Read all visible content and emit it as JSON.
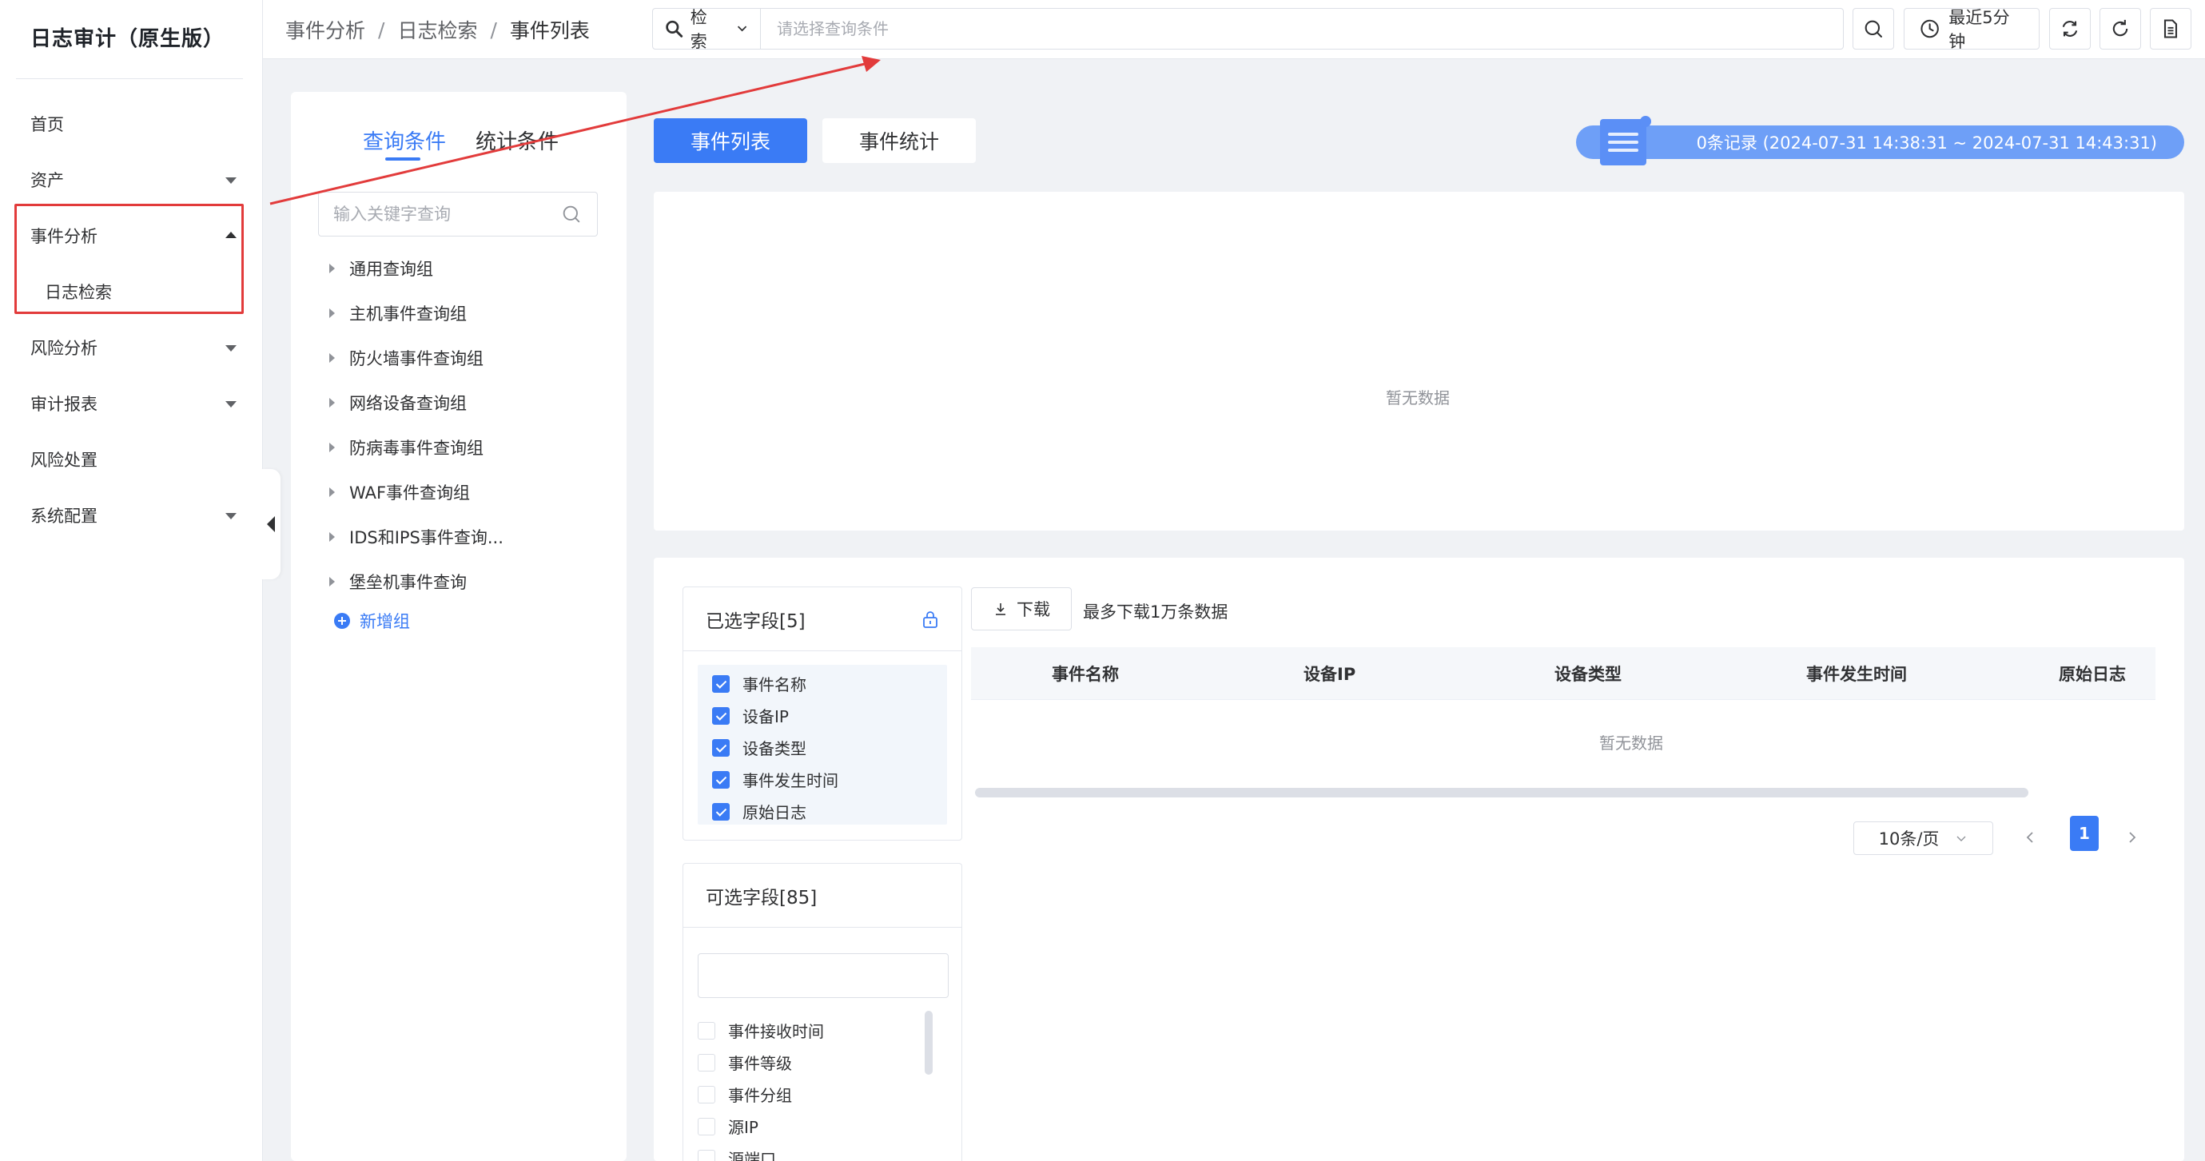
{
  "app": {
    "title": "日志审计（原生版）"
  },
  "sidebar": {
    "items": [
      {
        "label": "首页"
      },
      {
        "label": "资产"
      },
      {
        "label": "事件分析"
      },
      {
        "label": "日志检索"
      },
      {
        "label": "风险分析"
      },
      {
        "label": "审计报表"
      },
      {
        "label": "风险处置"
      },
      {
        "label": "系统配置"
      }
    ]
  },
  "header": {
    "breadcrumb": [
      "事件分析",
      "日志检索",
      "事件列表"
    ],
    "breadcrumb_sep": "/",
    "search_type": "检索",
    "search_placeholder": "请选择查询条件",
    "time_range": "最近5分钟"
  },
  "query_panel": {
    "tabs": [
      "查询条件",
      "统计条件"
    ],
    "search_placeholder": "输入关键字查询",
    "groups": [
      "通用查询组",
      "主机事件查询组",
      "防火墙事件查询组",
      "网络设备查询组",
      "防病毒事件查询组",
      "WAF事件查询组",
      "IDS和IPS事件查询...",
      "堡垒机事件查询"
    ],
    "add_group": "新增组"
  },
  "main": {
    "tabs": [
      "事件列表",
      "事件统计"
    ],
    "record_info": "0条记录 (2024-07-31 14:38:31 ~ 2024-07-31 14:43:31)",
    "chart_empty": "暂无数据"
  },
  "fields": {
    "selected_title": "已选字段[5]",
    "selected": [
      "事件名称",
      "设备IP",
      "设备类型",
      "事件发生时间",
      "原始日志"
    ],
    "optional_title": "可选字段[85]",
    "optional": [
      "事件接收时间",
      "事件等级",
      "事件分组",
      "源IP",
      "源端口"
    ]
  },
  "table": {
    "download_label": "下载",
    "download_note": "最多下载1万条数据",
    "columns": [
      "事件名称",
      "设备IP",
      "设备类型",
      "事件发生时间",
      "原始日志"
    ],
    "empty": "暂无数据"
  },
  "pagination": {
    "page_size": "10条/页",
    "current_page": "1"
  },
  "colors": {
    "accent": "#3a7bf5",
    "annotation": "#e23b3b",
    "record_bar": "#6e9ff7"
  }
}
